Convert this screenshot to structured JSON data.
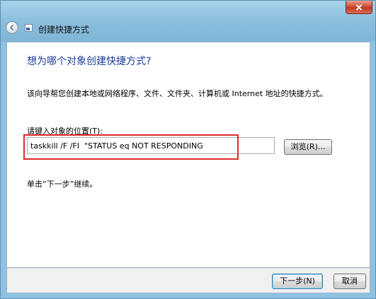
{
  "window": {
    "title": "创建快捷方式"
  },
  "icons": {
    "back": "back-arrow-icon",
    "wizard": "shortcut-wizard-icon",
    "close": "close-icon"
  },
  "colors": {
    "heading": "#1e3f9a",
    "highlight": "#e02a2a",
    "glass": "#8fc2e2"
  },
  "main": {
    "heading": "想为哪个对象创建快捷方式?",
    "description": "该向导帮您创建本地或网络程序、文件、文件夹、计算机或 Internet 地址的快捷方式。",
    "field_label": "请键入对象的位置(T):",
    "location_value": "taskkill /F /FI  \"STATUS eq NOT RESPONDING",
    "browse_label": "浏览(R)...",
    "hint": "单击“下一步”继续。"
  },
  "footer": {
    "next_label": "下一步(N)",
    "cancel_label": "取消"
  }
}
